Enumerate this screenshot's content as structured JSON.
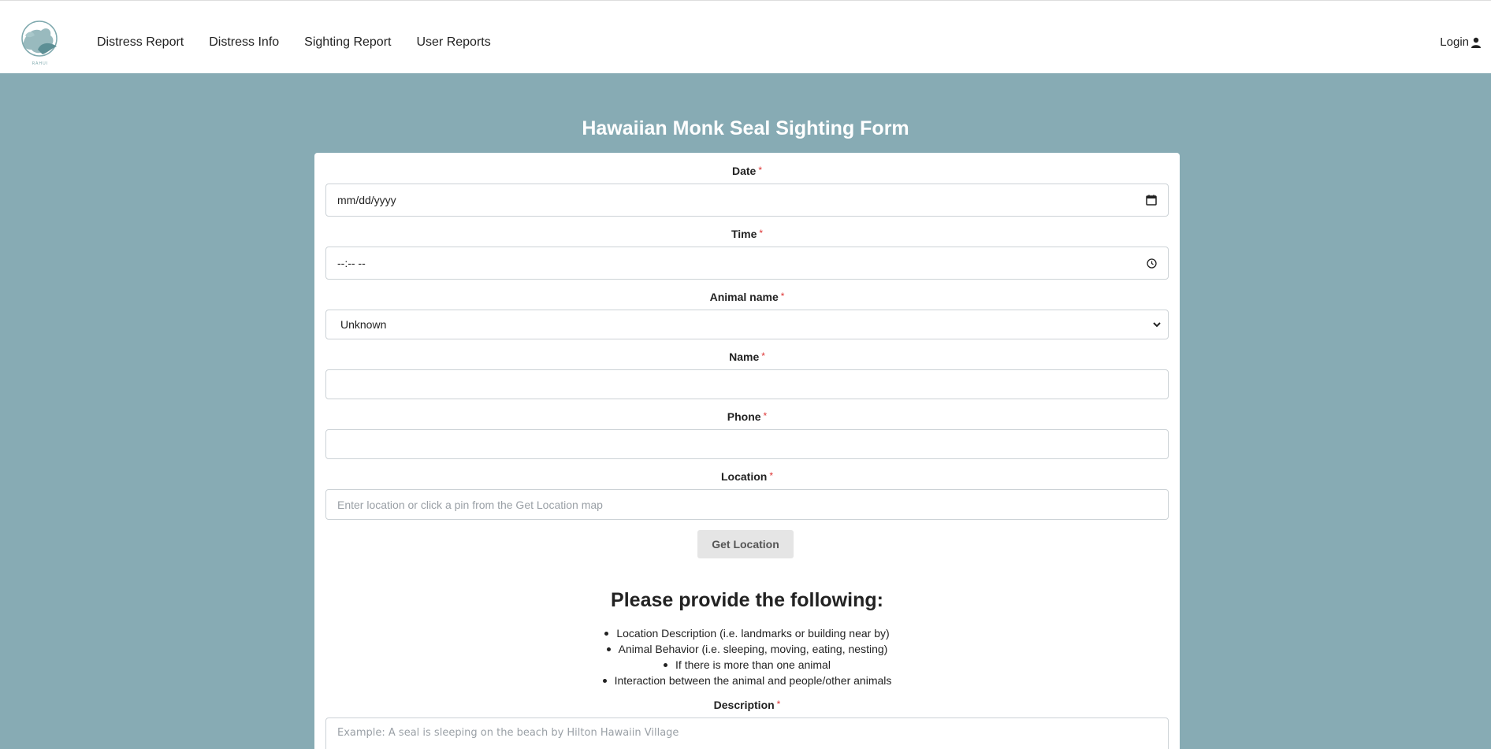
{
  "nav": {
    "logo_alt": "Rahui logo",
    "links": [
      "Distress Report",
      "Distress Info",
      "Sighting Report",
      "User Reports"
    ],
    "login": "Login"
  },
  "form": {
    "title": "Hawaiian Monk Seal Sighting Form",
    "date": {
      "label": "Date",
      "required": "*",
      "value": "mm/dd/yyyy",
      "icon": "calendar-icon"
    },
    "time": {
      "label": "Time",
      "required": "*",
      "value": "--:-- --",
      "icon": "clock-icon"
    },
    "animal_name": {
      "label": "Animal name",
      "required": "*",
      "value": "Unknown",
      "icon": "chevron-down-icon"
    },
    "name": {
      "label": "Name",
      "required": "*",
      "value": ""
    },
    "phone": {
      "label": "Phone",
      "required": "*",
      "value": ""
    },
    "location": {
      "label": "Location",
      "required": "*",
      "placeholder": "Enter location or click a pin from the Get Location map"
    },
    "get_location_button": "Get Location",
    "instructions_heading": "Please provide the following:",
    "instructions": [
      "Location Description (i.e. landmarks or building near by)",
      "Animal Behavior (i.e. sleeping, moving, eating, nesting)",
      "If there is more than one animal",
      "Interaction between the animal and people/other animals"
    ],
    "description": {
      "label": "Description",
      "required": "*",
      "placeholder": "Example: A seal is sleeping on the beach by Hilton Hawaiin Village"
    }
  },
  "colors": {
    "page_bg": "#87abb4",
    "required": "#dd3333"
  }
}
